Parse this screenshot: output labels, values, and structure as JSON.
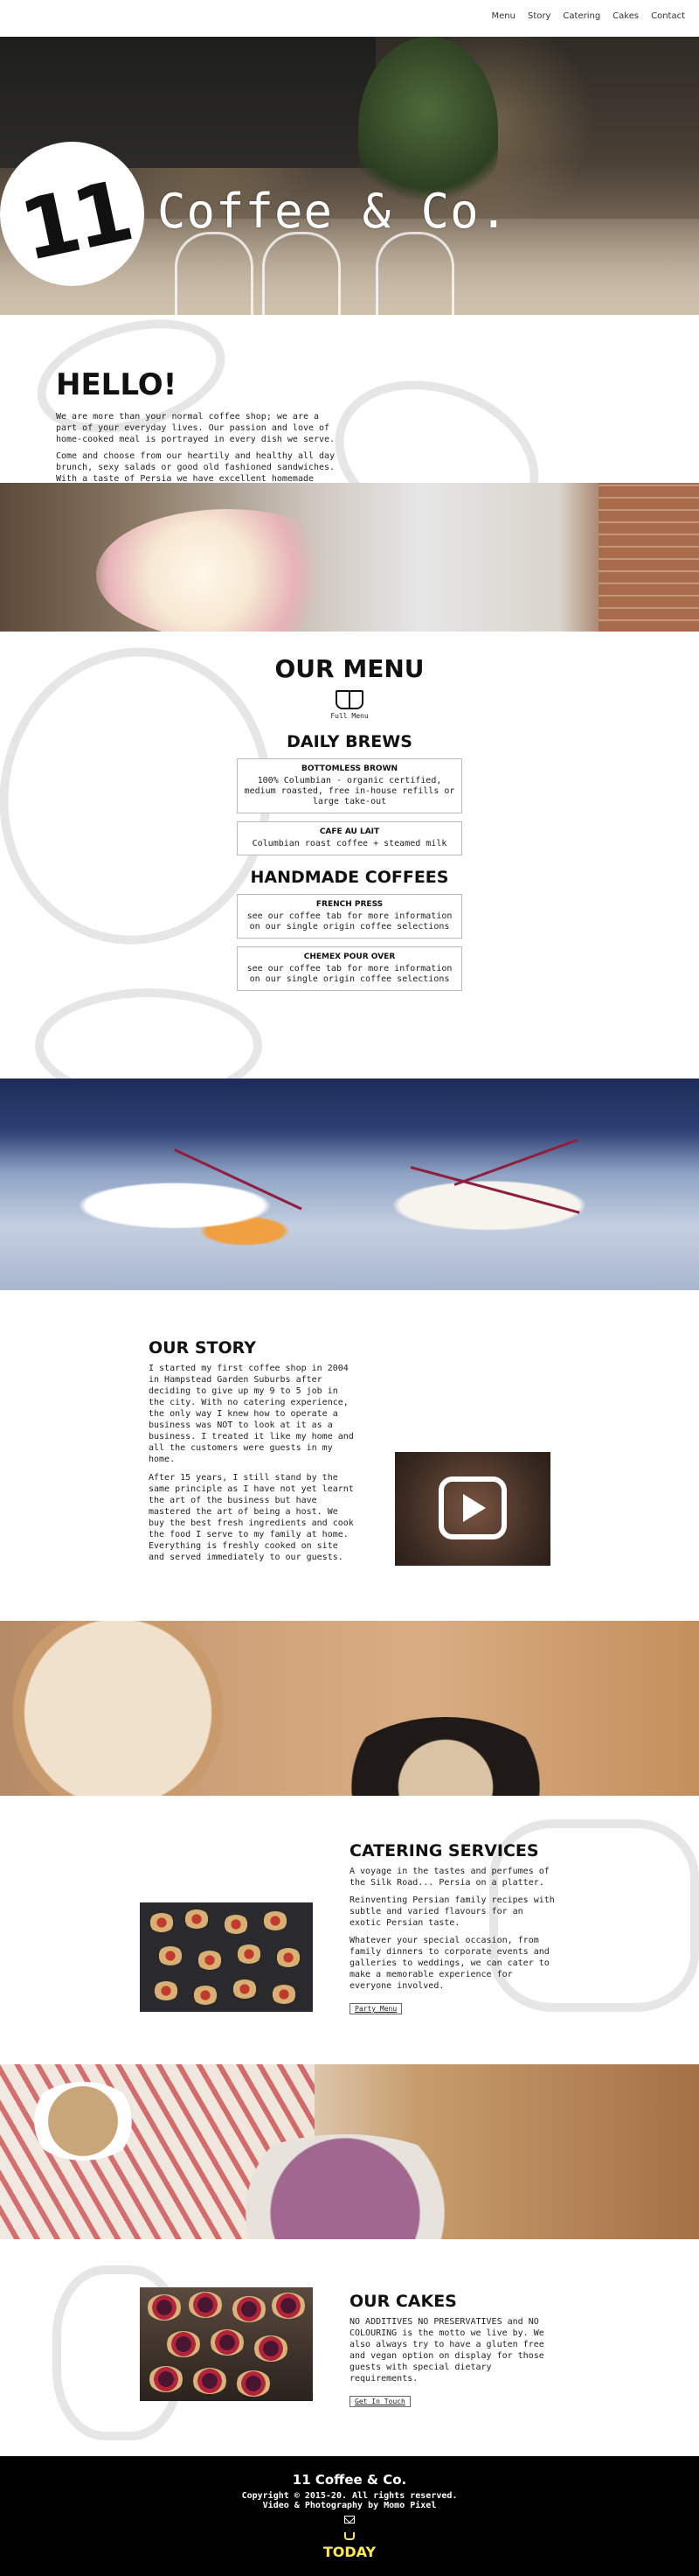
{
  "nav": {
    "items": [
      "Menu",
      "Story",
      "Catering",
      "Cakes",
      "Contact"
    ]
  },
  "hero": {
    "logo_number": "11",
    "brand_name": "Coffee & Co."
  },
  "hello": {
    "title": "HELLO!",
    "paragraphs": [
      "We are more than your normal coffee shop; we are a part of your everyday lives. Our passion and love of home-cooked meal is portrayed in every dish we serve.",
      "Come and choose from our heartily and healthy all day brunch, sexy salads or good old fashioned sandwiches. With a taste of Persia we have excellent homemade cakes, daily handmade desserts of freshly baked pastries and cookies. Last but by far not least, we have freshly baked bread which will leave you wanting more."
    ]
  },
  "menu": {
    "title": "OUR MENU",
    "full_menu_label": "Full Menu",
    "daily_brews_title": "DAILY BREWS",
    "daily_brews": [
      {
        "name": "BOTTOMLESS BROWN",
        "desc": "100% Columbian - organic certified, medium roasted, free in-house refills or large take-out"
      },
      {
        "name": "CAFE AU LAIT",
        "desc": "Columbian roast coffee + steamed milk"
      }
    ],
    "handmade_title": "HANDMADE COFFEES",
    "handmade": [
      {
        "name": "FRENCH PRESS",
        "desc": "see our coffee tab for more information on our single origin coffee selections"
      },
      {
        "name": "CHEMEX POUR OVER",
        "desc": "see our coffee tab for more information on our single origin coffee selections"
      }
    ]
  },
  "story": {
    "title": "OUR STORY",
    "paragraphs": [
      "I started my first coffee shop in 2004 in Hampstead Garden Suburbs after deciding to give up my 9 to 5 job in the city. With no catering experience, the only way I knew how to operate a business was NOT to look at it as a business. I treated it like my home and all the customers were guests in my home.",
      "After 15 years, I still stand by the same principle as I have not yet learnt the art of the business but have mastered the art of being a host. We buy the best fresh ingredients and cook the food I serve to my family at home. Everything is freshly cooked on site and served immediately to our guests."
    ]
  },
  "catering": {
    "title": "CATERING SERVICES",
    "paragraphs": [
      "A voyage in the tastes and perfumes of the Silk Road... Persia on a platter.",
      "Reinventing Persian family recipes with subtle and varied flavours for an exotic Persian taste.",
      "Whatever your special occasion, from family dinners to corporate events and galleries to weddings, we can cater to make a memorable experience for everyone involved."
    ],
    "button": "Party Menu"
  },
  "cakes": {
    "title": "OUR CAKES",
    "paragraph": "NO ADDITIVES NO PRESERVATIVES and NO COLOURING is the motto we live by. We also always try to have a gluten free and vegan option on display for those guests with special dietary requirements.",
    "button": "Get In Touch"
  },
  "footer": {
    "name": "11 Coffee & Co.",
    "copyright": "Copyright © 2015-20. All rights reserved.",
    "credit": "Video & Photography by Momo Pixel",
    "today": "TODAY"
  },
  "icons": {
    "full_menu": "open-book-icon",
    "video": "play-icon",
    "footer_contact": "envelope-icon",
    "footer_badge": "coffee-cup-icon"
  },
  "colors": {
    "accent": "#ffe94a",
    "footer_bg": "#000000"
  }
}
